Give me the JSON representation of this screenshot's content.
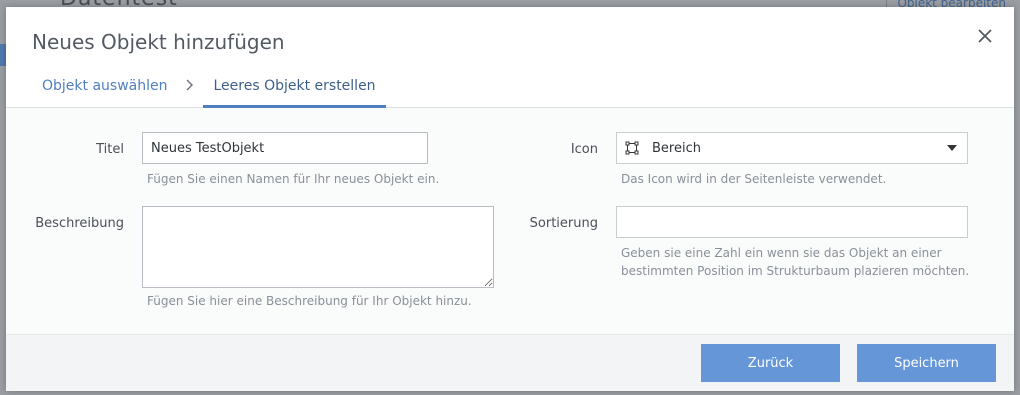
{
  "background": {
    "title": "Datentest",
    "right_action": "Objekt bearbeiten"
  },
  "dialog": {
    "title": "Neues Objekt hinzufügen",
    "close_icon": "close-icon"
  },
  "tabs": [
    {
      "label": "Objekt auswählen",
      "active": false
    },
    {
      "label": "Leeres Objekt erstellen",
      "active": true
    }
  ],
  "form": {
    "title_label": "Titel",
    "title_value": "Neues TestObjekt",
    "title_hint": "Fügen Sie einen Namen für Ihr neues Objekt ein.",
    "description_label": "Beschreibung",
    "description_value": "",
    "description_hint": "Fügen Sie hier eine Beschreibung für Ihr Objekt hinzu.",
    "icon_label": "Icon",
    "icon_selected": "Bereich",
    "icon_symbol": "area-icon",
    "icon_hint": "Das Icon wird in der Seitenleiste verwendet.",
    "sort_label": "Sortierung",
    "sort_value": "",
    "sort_hint_line1": "Geben sie eine Zahl ein wenn sie das Objekt an einer",
    "sort_hint_line2": "bestimmten Position im Strukturbaum plazieren möchten."
  },
  "footer": {
    "back_label": "Zurück",
    "save_label": "Speichern"
  },
  "colors": {
    "accent": "#6596d8",
    "tab_active": "#4f7fbf"
  }
}
